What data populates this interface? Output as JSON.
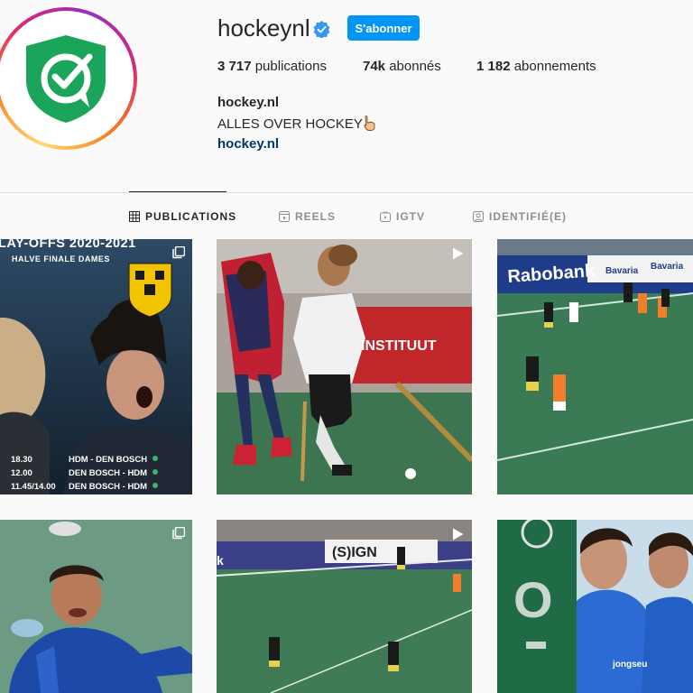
{
  "profile": {
    "username": "hockeynl",
    "follow_label": "S'abonner",
    "stats": {
      "posts_value": "3 717",
      "posts_label": "publications",
      "followers_value": "74k",
      "followers_label": "abonnés",
      "following_value": "1 182",
      "following_label": "abonnements"
    },
    "bio_name": "hockey.nl",
    "bio_text": "ALLES OVER HOCKEY",
    "bio_link": "hockey.nl"
  },
  "tabs": [
    {
      "label": "PUBLICATIONS",
      "icon": "grid-icon",
      "active": true
    },
    {
      "label": "REELS",
      "icon": "reels-icon",
      "active": false
    },
    {
      "label": "IGTV",
      "icon": "igtv-icon",
      "active": false
    },
    {
      "label": "IDENTIFIÉ(E)",
      "icon": "tagged-icon",
      "active": false
    }
  ],
  "posts": [
    {
      "title": "LAY-OFFS 2020-2021",
      "subtitle": "HALVE FINALE DAMES",
      "schedule": [
        {
          "time": "18.30",
          "match": "HDM - DEN BOSCH"
        },
        {
          "time": "12.00",
          "match": "DEN BOSCH - HDM"
        },
        {
          "time": "11.45/14.00",
          "match": "DEN BOSCH - HDM"
        }
      ]
    },
    {
      "banner": "INSTITUUT"
    },
    {
      "banner": "Rabobank",
      "banner2": "Bavaria",
      "banner3": "Bavaria"
    },
    {},
    {
      "banner": "(S)IGN",
      "banner2": "k"
    },
    {
      "shirt": "jongseu"
    }
  ],
  "colors": {
    "accent": "#0095f6",
    "link": "#00376b",
    "logo_green": "#1aa55a",
    "pitch_green": "#3a7a55"
  }
}
